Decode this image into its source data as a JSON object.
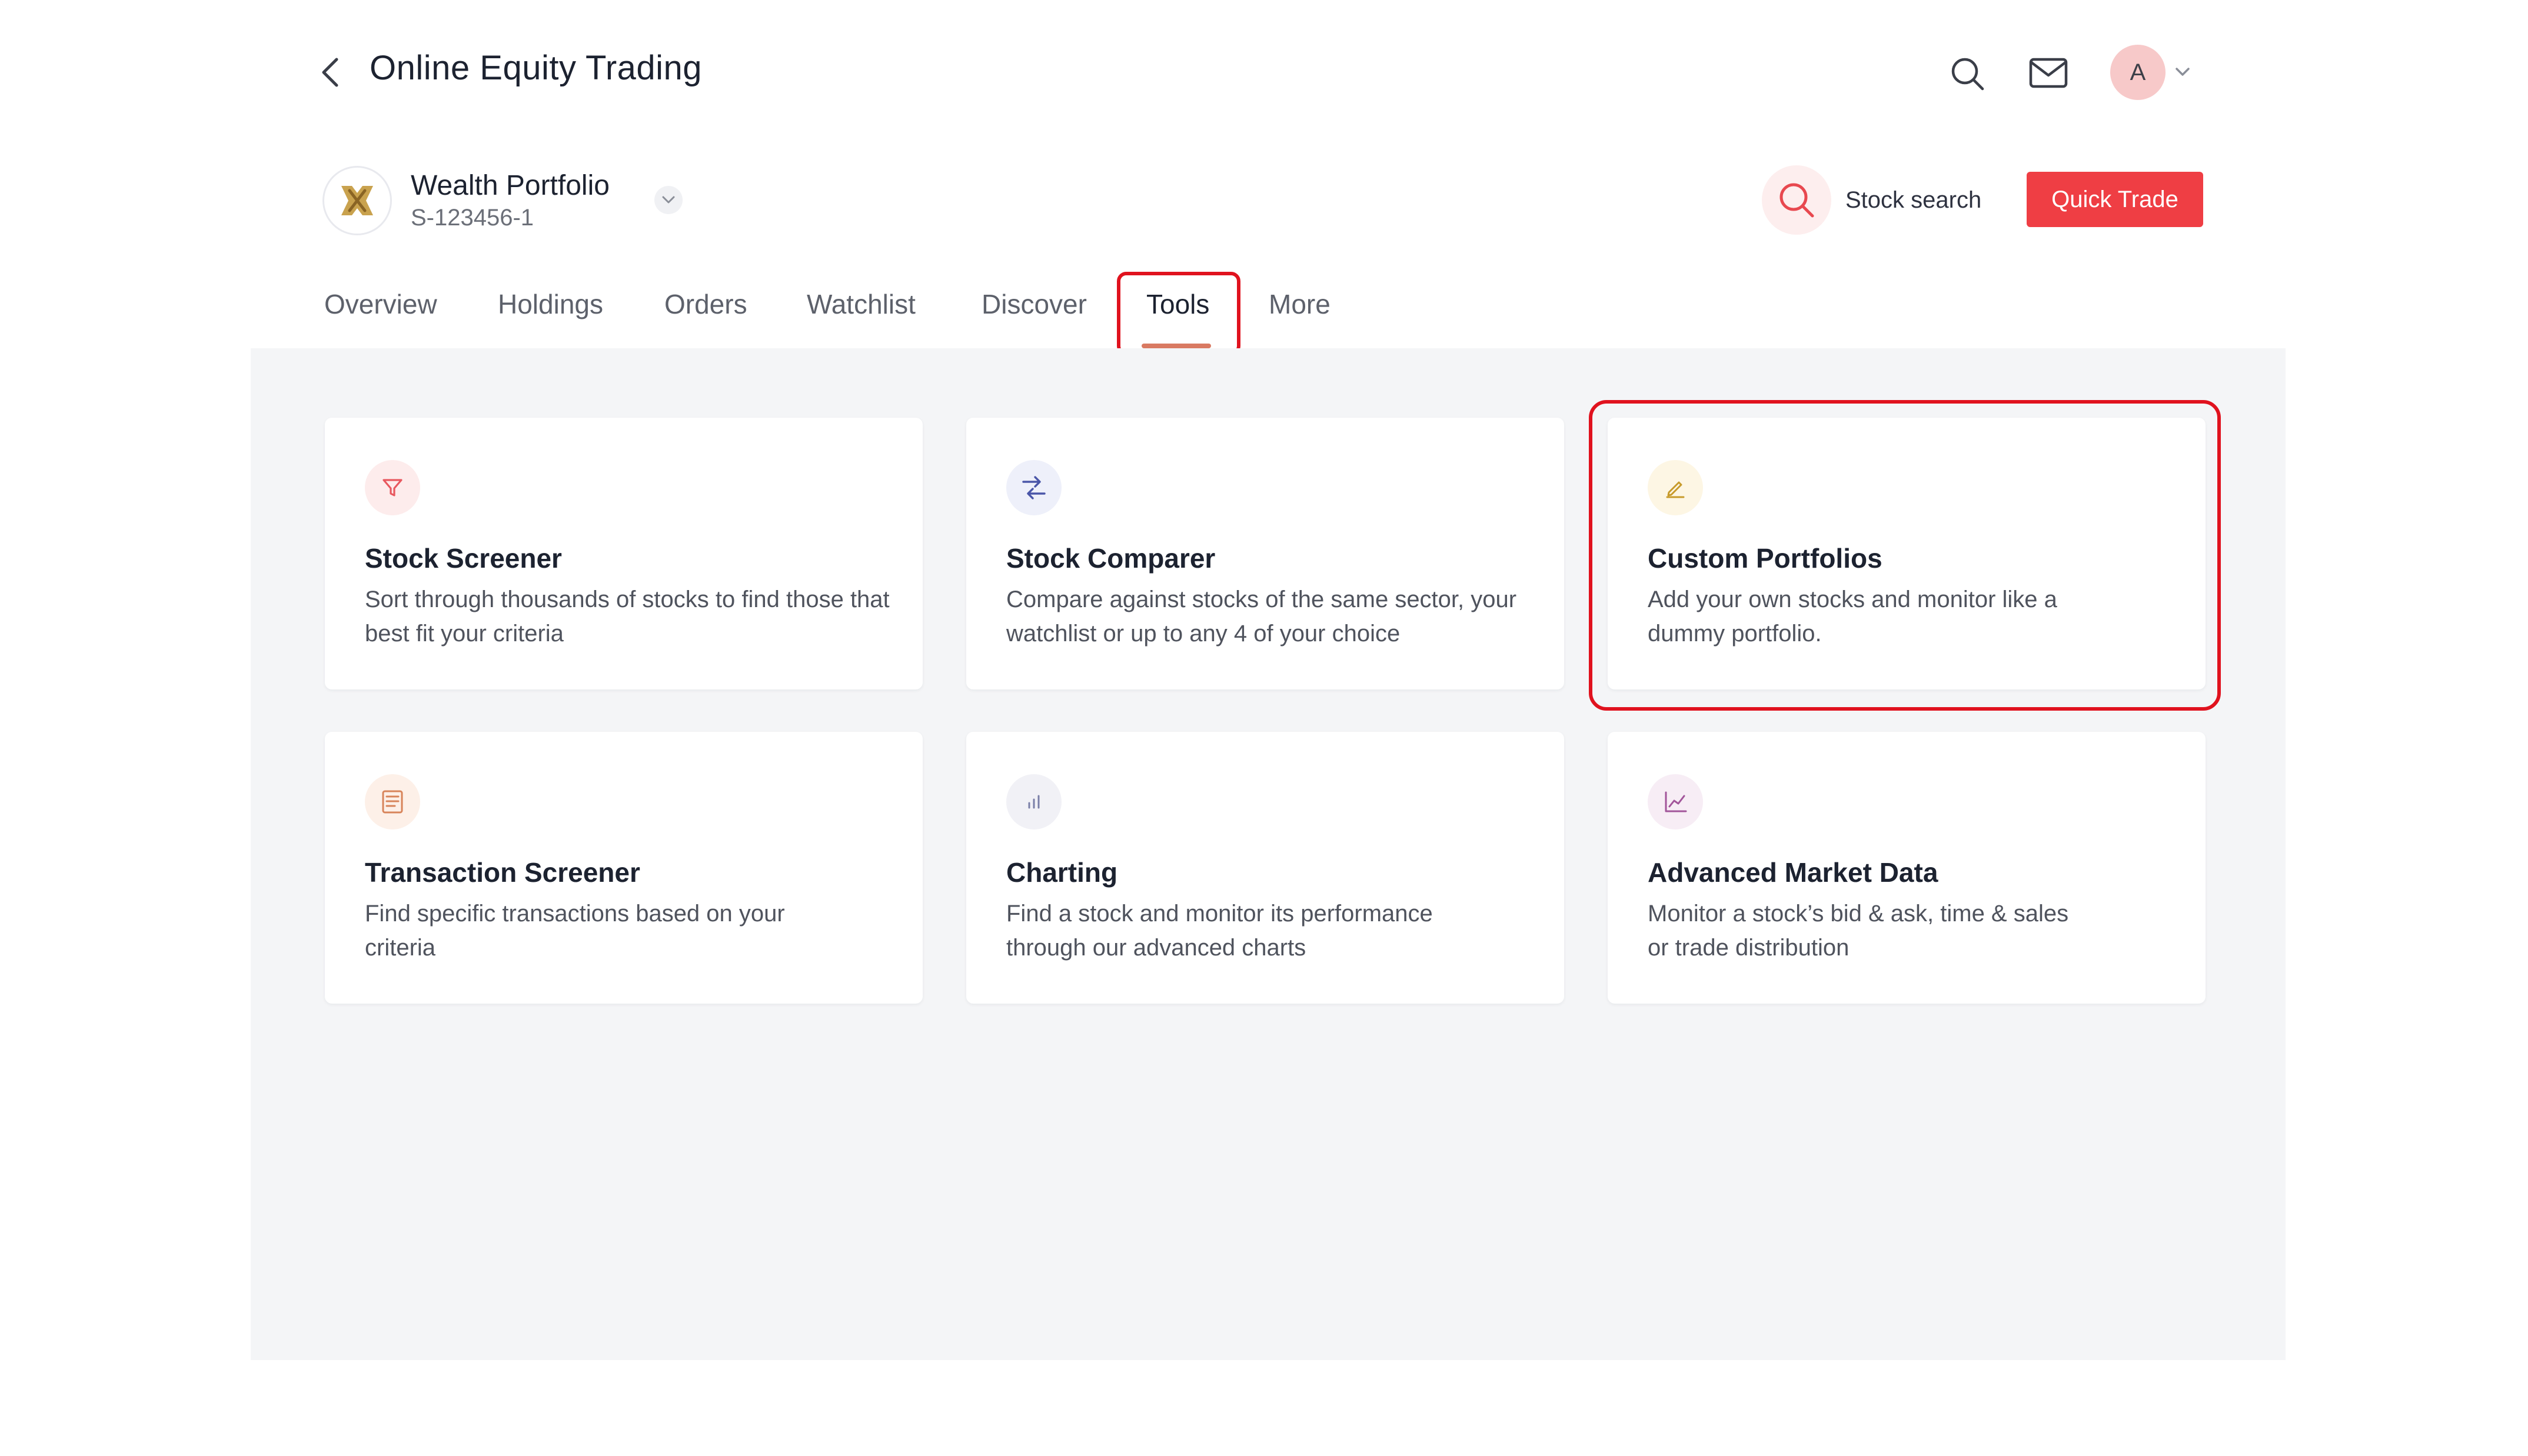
{
  "header": {
    "title": "Online Equity Trading",
    "avatar_initial": "A"
  },
  "portfolio": {
    "name": "Wealth Portfolio",
    "id": "S-123456-1"
  },
  "actions": {
    "stock_search_label": "Stock search",
    "quick_trade_label": "Quick Trade"
  },
  "tabs": [
    {
      "label": "Overview"
    },
    {
      "label": "Holdings"
    },
    {
      "label": "Orders"
    },
    {
      "label": "Watchlist"
    },
    {
      "label": "Discover"
    },
    {
      "label": "Tools",
      "active": true
    },
    {
      "label": "More"
    }
  ],
  "tools": [
    {
      "title": "Stock Screener",
      "description": "Sort through thousands of stocks to find those that best fit your criteria",
      "icon": "filter-icon",
      "icon_color": "#e8585f",
      "icon_bg": "#fdecec"
    },
    {
      "title": "Stock Comparer",
      "description": "Compare against stocks of the same sector, your watchlist or up to any 4 of your choice",
      "icon": "compare-arrows-icon",
      "icon_color": "#4a56a8",
      "icon_bg": "#eef0fa"
    },
    {
      "title": "Custom Portfolios",
      "description": "Add your own stocks and monitor like a dummy portfolio.",
      "icon": "pencil-icon",
      "icon_color": "#c79a2a",
      "icon_bg": "#fdf6e4"
    },
    {
      "title": "Transaction Screener",
      "description": "Find specific transactions based on your criteria",
      "icon": "document-list-icon",
      "icon_color": "#d8845a",
      "icon_bg": "#fdf0e8"
    },
    {
      "title": "Charting",
      "description": "Find a stock and monitor its performance through our advanced charts",
      "icon": "bar-chart-icon",
      "icon_color": "#7a7fa8",
      "icon_bg": "#f1f1f6"
    },
    {
      "title": "Advanced Market Data",
      "description": "Monitor a stock’s bid & ask, time & sales or trade distribution",
      "icon": "line-chart-icon",
      "icon_color": "#a2559a",
      "icon_bg": "#f7edf5"
    }
  ],
  "colors": {
    "accent_red": "#ef3e44",
    "highlight_red": "#e0121e",
    "tab_underline": "#d97a62",
    "content_bg": "#f4f5f7"
  }
}
